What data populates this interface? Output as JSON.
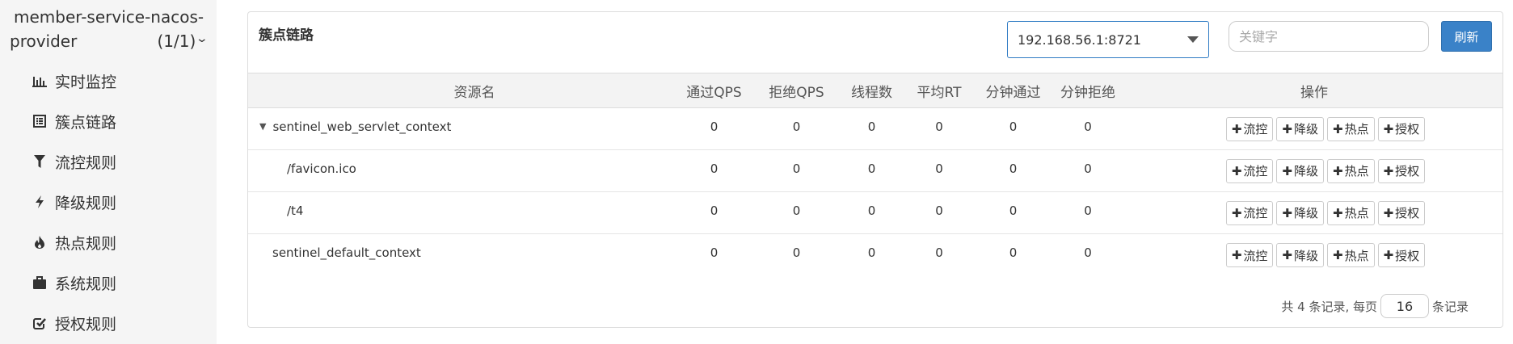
{
  "sidebar": {
    "service_name_line1": "member-service-nacos-",
    "service_name_line2": "provider",
    "instance_count": "(1/1)",
    "items": [
      {
        "label": "实时监控",
        "icon": "bar-chart-icon"
      },
      {
        "label": "簇点链路",
        "icon": "list-icon"
      },
      {
        "label": "流控规则",
        "icon": "filter-icon"
      },
      {
        "label": "降级规则",
        "icon": "flash-icon"
      },
      {
        "label": "热点规则",
        "icon": "fire-icon"
      },
      {
        "label": "系统规则",
        "icon": "briefcase-icon"
      },
      {
        "label": "授权规则",
        "icon": "check-square-icon"
      }
    ]
  },
  "panel": {
    "title": "簇点链路",
    "machine_select_value": "192.168.56.1:8721",
    "search_placeholder": "关键字",
    "refresh_label": "刷新"
  },
  "table": {
    "headers": [
      "资源名",
      "通过QPS",
      "拒绝QPS",
      "线程数",
      "平均RT",
      "分钟通过",
      "分钟拒绝",
      "操作"
    ],
    "rows": [
      {
        "name": "sentinel_web_servlet_context",
        "values": [
          "0",
          "0",
          "0",
          "0",
          "0",
          "0"
        ]
      },
      {
        "name": "/favicon.ico",
        "values": [
          "0",
          "0",
          "0",
          "0",
          "0",
          "0"
        ]
      },
      {
        "name": "/t4",
        "values": [
          "0",
          "0",
          "0",
          "0",
          "0",
          "0"
        ]
      },
      {
        "name": "sentinel_default_context",
        "values": [
          "0",
          "0",
          "0",
          "0",
          "0",
          "0"
        ]
      }
    ],
    "op_labels": {
      "flow": "流控",
      "degrade": "降级",
      "hot": "热点",
      "auth": "授权"
    }
  },
  "pager": {
    "prefix": "共 4 条记录, 每页",
    "page_size": "16",
    "suffix": "条记录"
  },
  "colors": {
    "accent": "#3a82c8",
    "sidebar_bg": "#f5f5f5",
    "header_bg": "#f3f3f3"
  }
}
